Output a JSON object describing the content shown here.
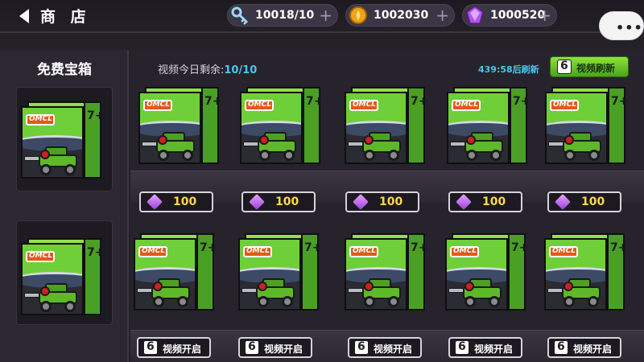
{
  "header": {
    "title": "商 店",
    "resources": [
      {
        "name": "keys",
        "icon": "key-icon",
        "value": "10018/10"
      },
      {
        "name": "coins",
        "icon": "coin-icon",
        "value": "1002030"
      },
      {
        "name": "gems",
        "icon": "gem-icon",
        "value": "1000520"
      }
    ],
    "more_label": "•••"
  },
  "free_chests": {
    "title": "免费宝箱",
    "items": [
      {
        "logo": "OMCL",
        "age": "7+"
      },
      {
        "logo": "OMCL",
        "age": "7+"
      }
    ]
  },
  "shop": {
    "video_prefix": "视频今日剩余:",
    "video_count": "10/10",
    "refresh_timer": "439:58后刷新",
    "refresh_button": "视频刷新",
    "row1": [
      {
        "logo": "OMCL",
        "age": "7+",
        "price": "100"
      },
      {
        "logo": "OMCL",
        "age": "7+",
        "price": "100"
      },
      {
        "logo": "OMCL",
        "age": "7+",
        "price": "100"
      },
      {
        "logo": "OMCL",
        "age": "7+",
        "price": "100"
      },
      {
        "logo": "OMCL",
        "age": "7+",
        "price": "100"
      }
    ],
    "row2": [
      {
        "logo": "OMCL",
        "age": "7+",
        "action": "视频开启"
      },
      {
        "logo": "OMCL",
        "age": "7+",
        "action": "视频开启"
      },
      {
        "logo": "OMCL",
        "age": "7+",
        "action": "视频开启"
      },
      {
        "logo": "OMCL",
        "age": "7+",
        "action": "视频开启"
      },
      {
        "logo": "OMCL",
        "age": "7+",
        "action": "视频开启"
      }
    ]
  },
  "colors": {
    "background": "#242127",
    "accent_blue": "#47c8f0",
    "refresh_green": "#6cc82c",
    "price_yellow": "#ffd84a",
    "box_green": "#6fcf38"
  }
}
